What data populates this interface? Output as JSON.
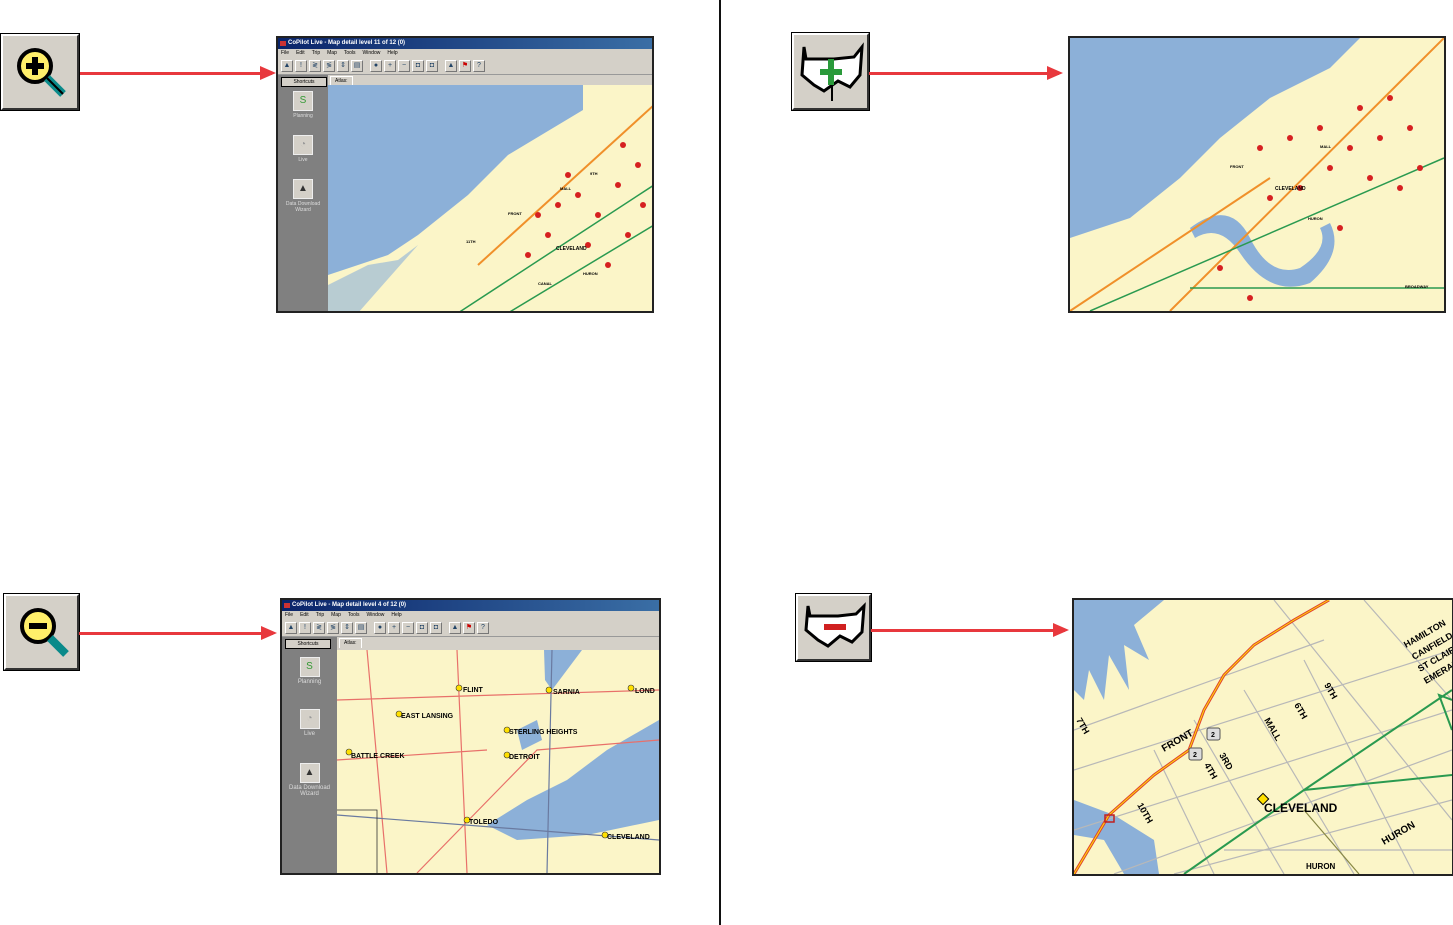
{
  "app": {
    "menu": [
      "File",
      "Edit",
      "Trip",
      "Map",
      "Tools",
      "Window",
      "Help"
    ],
    "shortcuts_label": "Shortcuts",
    "atlas_tab": "Atlas:",
    "shortcut_items": [
      "Planning",
      "Live",
      "Data Download Wizard"
    ]
  },
  "screens": {
    "zoom_in": {
      "title": "CoPilot Live - Map detail level 11 of 12 (0)",
      "labels": [
        "CLEVELAND",
        "HURON",
        "CANAL",
        "FRONT",
        "MALL",
        "9TH",
        "11TH"
      ]
    },
    "zoom_out": {
      "title": "CoPilot Live - Map detail level 4 of 12 (0)",
      "labels": [
        "FLINT",
        "SARNIA",
        "LOND",
        "EAST LANSING",
        "STERLING HEIGHTS",
        "BATTLE CREEK",
        "DETROIT",
        "TOLEDO",
        "CLEVELAND"
      ]
    },
    "detail_in": {
      "labels": [
        "CLEVELAND",
        "HURON",
        "FRONT",
        "MALL",
        "BROADWAY"
      ]
    },
    "detail_out": {
      "labels": [
        "CLEVELAND",
        "HURON",
        "HURON",
        "FRONT",
        "MALL",
        "9TH",
        "6TH",
        "3RD",
        "4TH",
        "10TH",
        "7TH",
        "HAMILTON",
        "CANFIELD",
        "ST CLAIR",
        "EMERALD"
      ],
      "shields": [
        "2",
        "2"
      ]
    }
  },
  "icons": {
    "zoom_in": "magnifier-plus-icon",
    "zoom_out": "magnifier-minus-icon",
    "more_detail": "us-map-plus-icon",
    "less_detail": "us-map-minus-icon"
  },
  "colors": {
    "arrow": "#e8383d",
    "water": "#8cb0d8",
    "land": "#fbf5c8",
    "road": "#e8706a",
    "highway": "#2a9a50"
  }
}
